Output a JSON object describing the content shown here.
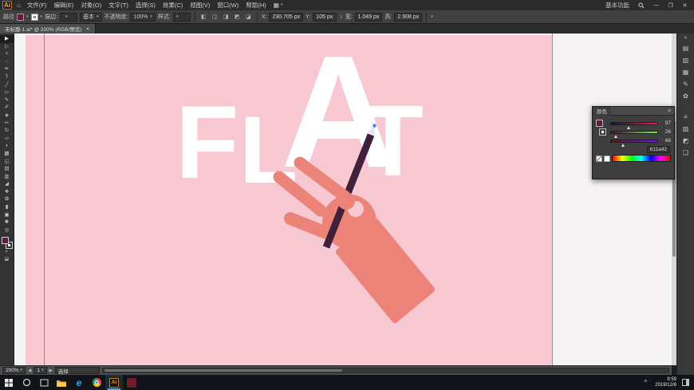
{
  "colors": {
    "menubar-bg": "#2b2b2b",
    "controlbar-bg": "#404040",
    "tabrow-bg": "#2b2b2b",
    "toolbar-bg": "#333333",
    "panel-bg": "#3e3e3e",
    "canvas-bg": "#f6f3f4",
    "artboard-pink": "#f8c8d3",
    "hand-color": "#ec8378",
    "pencil-color": "#40203a",
    "pencil-tip": "#e3e6f5",
    "pencil-lead": "#5f7fe8",
    "fill-swatch": "#611a42",
    "taskbar-bg": "#101418"
  },
  "icons": {
    "caret": "▾",
    "home": "⌂",
    "grid": "▦",
    "menu": "≡",
    "collapse": "«",
    "chain": "∞",
    "tray_up": "^",
    "prev": "◀",
    "next": "▶"
  },
  "menubar": {
    "logo": "Ai",
    "menus": [
      "文件(F)",
      "编辑(E)",
      "对象(O)",
      "文字(T)",
      "选择(S)",
      "效果(C)",
      "视图(V)",
      "窗口(W)",
      "帮助(H)"
    ],
    "workspace": "基本功能",
    "window": {
      "minimize": "—",
      "maximize": "❐",
      "close": "✕"
    }
  },
  "controlbar": {
    "context": "路径",
    "stroke_label": "描边:",
    "stroke_value": "",
    "brush_value": "基本",
    "opacity_label": "不透明度:",
    "opacity_value": "100%",
    "style_label": "样式:",
    "align_icons": [
      "◧",
      "◫",
      "◨",
      "◩",
      "◪"
    ],
    "fields": {
      "x_label": "X:",
      "x_value": "230.705 px",
      "y_label": "Y:",
      "y_value": "105 px",
      "w_label": "宽:",
      "w_value": "1.049 px",
      "h_label": "高:",
      "h_value": "2.908 px"
    }
  },
  "tabs": {
    "doc": "未标题-1.ai* @ 200% (RGB/预览)",
    "close": "✕"
  },
  "toolbar": {
    "tools": [
      {
        "name": "selection-tool",
        "glyph": "▶"
      },
      {
        "name": "direct-selection-tool",
        "glyph": "▷"
      },
      {
        "name": "magic-wand-tool",
        "glyph": "✧"
      },
      {
        "name": "lasso-tool",
        "glyph": "◌"
      },
      {
        "name": "pen-tool",
        "glyph": "✒"
      },
      {
        "name": "type-tool",
        "glyph": "T"
      },
      {
        "name": "line-segment-tool",
        "glyph": "╱"
      },
      {
        "name": "rectangle-tool",
        "glyph": "▭"
      },
      {
        "name": "paintbrush-tool",
        "glyph": "✎"
      },
      {
        "name": "pencil-tool",
        "glyph": "✐"
      },
      {
        "name": "eraser-tool",
        "glyph": "◈"
      },
      {
        "name": "scissors-tool",
        "glyph": "✂"
      },
      {
        "name": "rotate-tool",
        "glyph": "↻"
      },
      {
        "name": "scale-tool",
        "glyph": "▱"
      },
      {
        "name": "width-tool",
        "glyph": "◖"
      },
      {
        "name": "free-transform-tool",
        "glyph": "▩"
      },
      {
        "name": "shape-builder-tool",
        "glyph": "◱"
      },
      {
        "name": "mesh-tool",
        "glyph": "▤"
      },
      {
        "name": "gradient-tool",
        "glyph": "▥"
      },
      {
        "name": "eyedropper-tool",
        "glyph": "◢"
      },
      {
        "name": "blend-tool",
        "glyph": "❖"
      },
      {
        "name": "symbol-sprayer-tool",
        "glyph": "✿"
      },
      {
        "name": "column-graph-tool",
        "glyph": "▮"
      },
      {
        "name": "artboard-tool",
        "glyph": "▣"
      },
      {
        "name": "hand-tool",
        "glyph": "✱"
      },
      {
        "name": "zoom-tool",
        "glyph": "◎"
      }
    ]
  },
  "artboard": {
    "letters": [
      "F",
      "L",
      "A",
      "T"
    ]
  },
  "dock": {
    "icons": [
      {
        "name": "color-panel-icon",
        "glyph": "▤"
      },
      {
        "name": "color-guide-panel-icon",
        "glyph": "▥"
      },
      {
        "name": "swatches-panel-icon",
        "glyph": "▦"
      },
      {
        "name": "brushes-panel-icon",
        "glyph": "✎"
      },
      {
        "name": "symbols-panel-icon",
        "glyph": "✿"
      },
      {
        "name": "stroke-panel-icon",
        "glyph": "≡"
      },
      {
        "name": "gradient-panel-icon",
        "glyph": "▧"
      },
      {
        "name": "transparency-panel-icon",
        "glyph": "◩"
      },
      {
        "name": "layers-panel-icon",
        "glyph": "❏"
      }
    ]
  },
  "color_panel": {
    "title": "颜色",
    "values": [
      "97",
      "26",
      "66"
    ],
    "hex": "611a42"
  },
  "statusbar": {
    "zoom": "200%",
    "artboard_nav": "1",
    "tool": "选择"
  },
  "taskbar": {
    "ai_label": "Ai",
    "time": "9:59",
    "date": "2019/12/8"
  }
}
